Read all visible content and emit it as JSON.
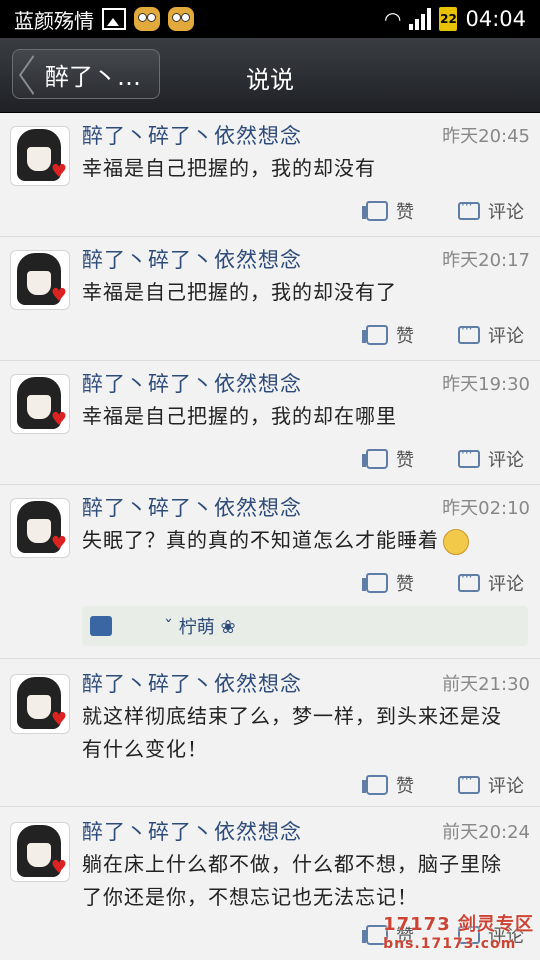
{
  "status_bar": {
    "carrier": "蓝颜殇情",
    "battery": "22",
    "time": "04:04"
  },
  "header": {
    "back_label": "醉了丶…",
    "title": "说说"
  },
  "posts": [
    {
      "name": "醉了丶碎了丶依然想念",
      "time": "昨天20:45",
      "content": "幸福是自己把握的，我的却没有",
      "like_label": "赞",
      "comment_label": "评论"
    },
    {
      "name": "醉了丶碎了丶依然想念",
      "time": "昨天20:17",
      "content": "幸福是自己把握的，我的却没有了",
      "like_label": "赞",
      "comment_label": "评论"
    },
    {
      "name": "醉了丶碎了丶依然想念",
      "time": "昨天19:30",
      "content": "幸福是自己把握的，我的却在哪里",
      "like_label": "赞",
      "comment_label": "评论"
    },
    {
      "name": "醉了丶碎了丶依然想念",
      "time": "昨天02:10",
      "content": "失眠了？真的真的不知道怎么才能睡着",
      "like_label": "赞",
      "comment_label": "评论",
      "liked_by": "ˇ          柠萌 ❀"
    },
    {
      "name": "醉了丶碎了丶依然想念",
      "time": "前天21:30",
      "content": "就这样彻底结束了么，梦一样，到头来还是没有什么变化！",
      "like_label": "赞",
      "comment_label": "评论"
    },
    {
      "name": "醉了丶碎了丶依然想念",
      "time": "前天20:24",
      "content": "躺在床上什么都不做，什么都不想，脑子里除了你还是你，不想忘记也无法忘记！",
      "like_label": "赞",
      "comment_label": "评论"
    }
  ],
  "watermark": {
    "line1": "17173 剑灵专区",
    "line2": "bns.17173.com"
  },
  "icons": [
    "wifi-icon",
    "signal-icon",
    "battery-icon",
    "image-icon",
    "like-icon",
    "comment-icon",
    "back-icon"
  ]
}
